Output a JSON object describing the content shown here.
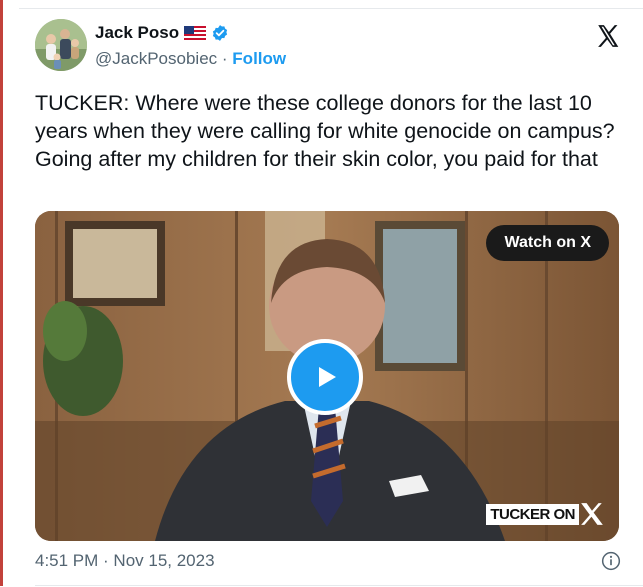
{
  "author": {
    "name": "Jack Poso",
    "handle": "@JackPosobiec",
    "separator": "·",
    "follow_label": "Follow"
  },
  "icons": {
    "flag": "us-flag-icon",
    "verified": "verified-badge-icon",
    "platform": "x-logo-icon",
    "play": "play-icon",
    "info": "info-icon"
  },
  "tweet": {
    "text": "TUCKER: Where were these college donors for the last 10 years when they were calling for white genocide on campus? Going after my children for their skin color, you paid for that"
  },
  "media": {
    "watch_label": "Watch on X",
    "brand_label": "TUCKER ON"
  },
  "footer": {
    "timestamp": "4:51 PM · Nov 15, 2023"
  },
  "colors": {
    "accent": "#1d9bf0",
    "text": "#0f1419",
    "muted": "#536471",
    "left_rule": "#c2413b"
  }
}
